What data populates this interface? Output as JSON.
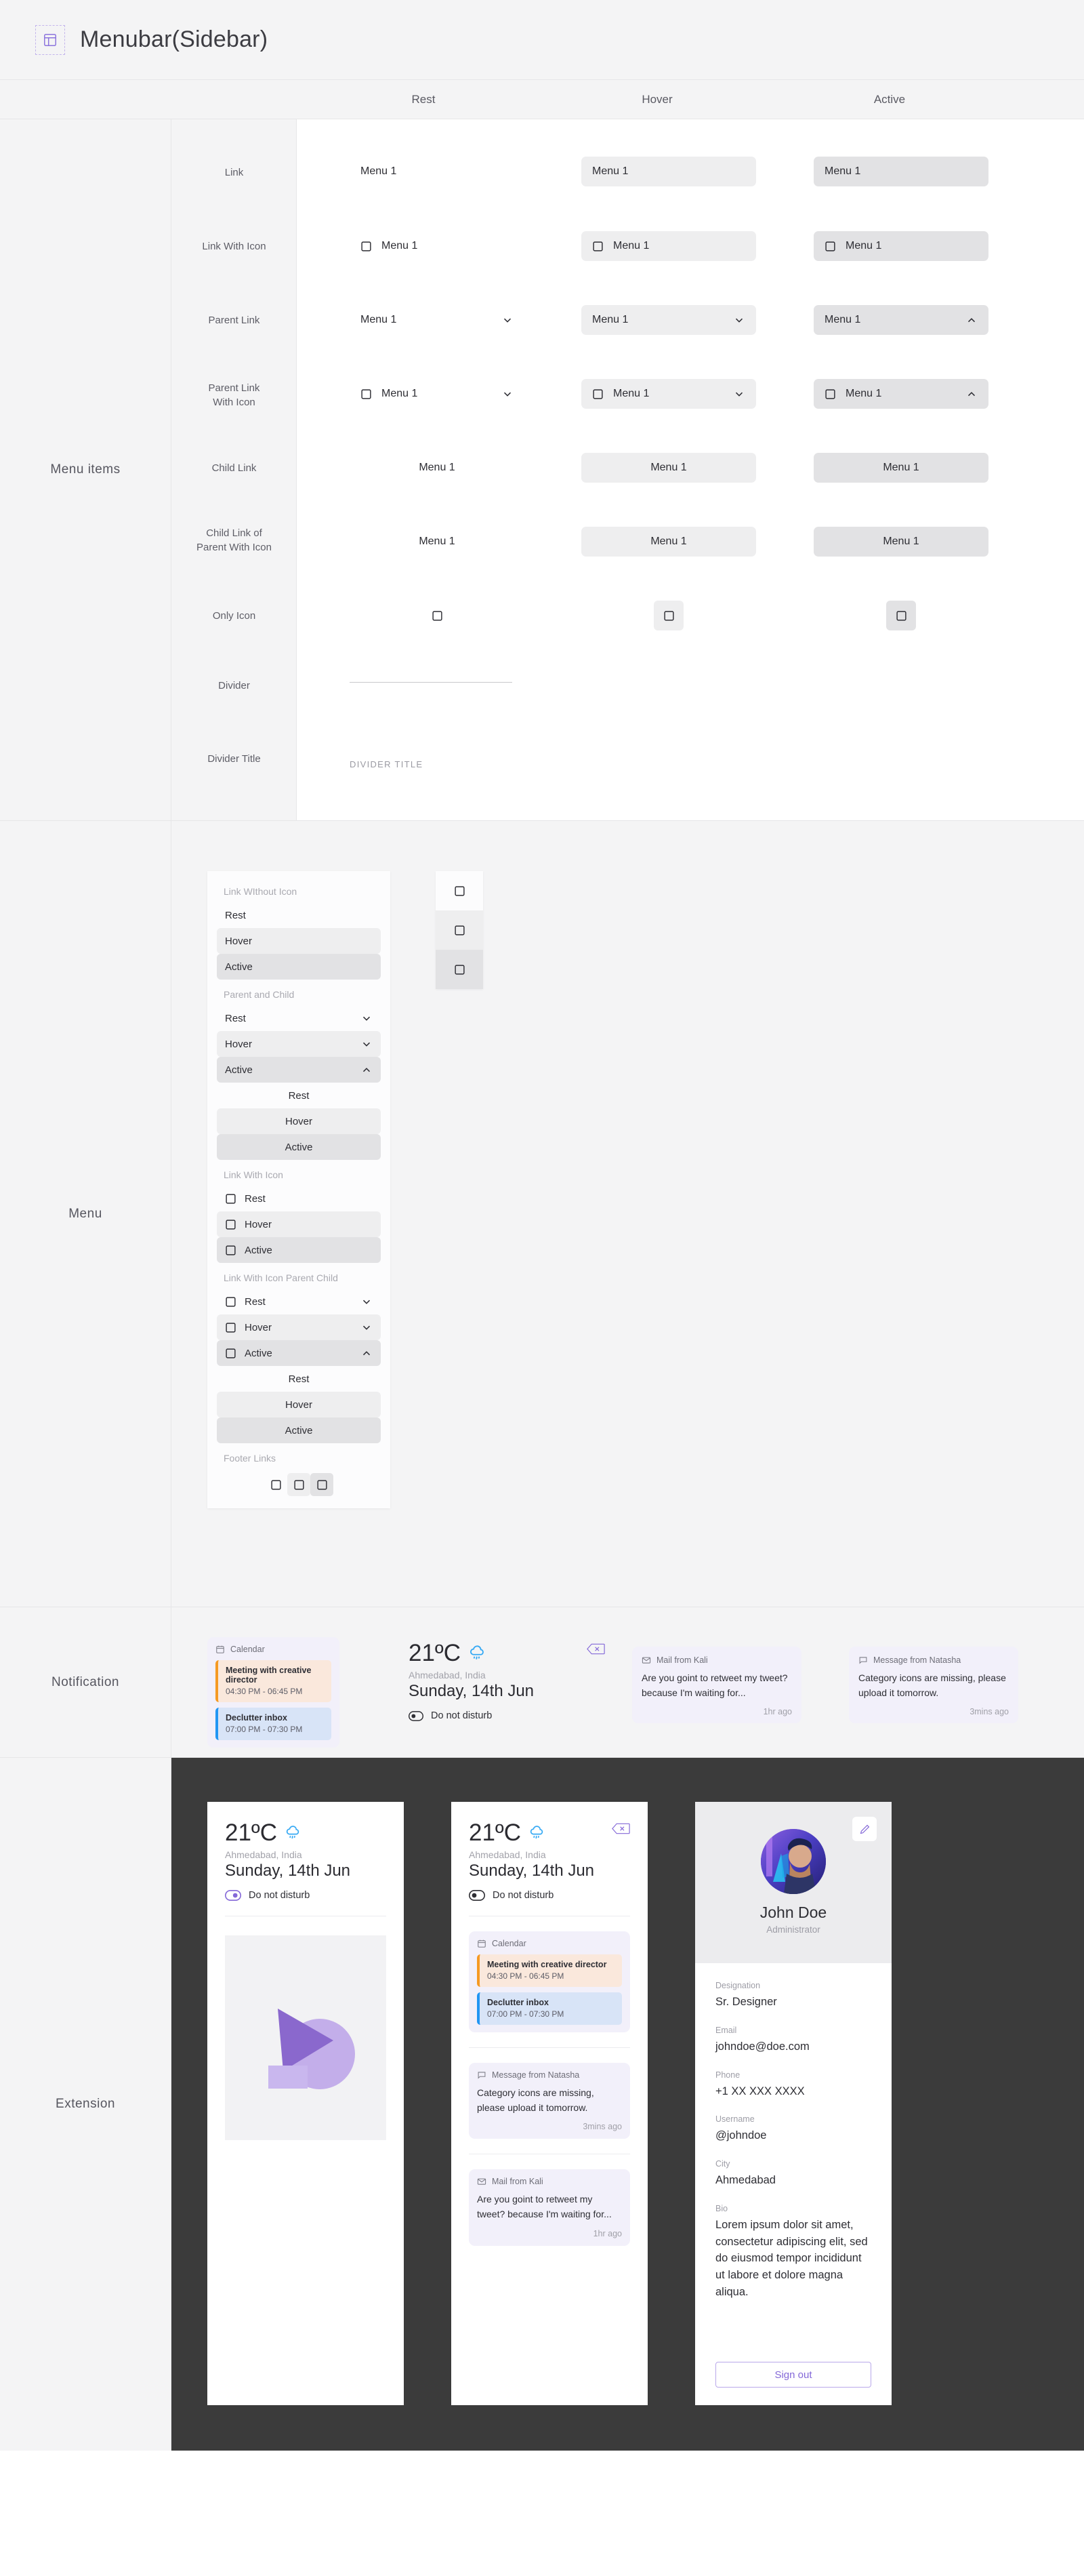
{
  "topbar": {
    "icon": "layout-sidebar-icon",
    "title": "Menubar(Sidebar)"
  },
  "state_columns": {
    "rest": "Rest",
    "hover": "Hover",
    "active": "Active"
  },
  "menu_items_section": {
    "label": "Menu items",
    "rows": [
      {
        "label": "Link",
        "sample": "Menu 1"
      },
      {
        "label": "Link With Icon",
        "sample": "Menu 1"
      },
      {
        "label": "Parent Link",
        "sample": "Menu 1"
      },
      {
        "label": "Parent Link\nWith Icon",
        "line1": "Parent Link",
        "line2": "With Icon",
        "sample": "Menu 1"
      },
      {
        "label": "Child Link",
        "sample": "Menu 1"
      },
      {
        "label": "Child Link of\nParent With Icon",
        "line1": "Child Link of",
        "line2": "Parent With Icon",
        "sample": "Menu 1"
      },
      {
        "label": "Only Icon",
        "sample": ""
      },
      {
        "label": "Divider",
        "sample": ""
      },
      {
        "label": "Divider Title",
        "sample": "DIVIDER TITLE"
      }
    ]
  },
  "menu_section": {
    "label": "Menu",
    "groups": [
      {
        "title": "Link WIthout Icon",
        "items": [
          {
            "label": "Rest",
            "state": "rest",
            "icon": false,
            "chevron": ""
          },
          {
            "label": "Hover",
            "state": "hover",
            "icon": false,
            "chevron": ""
          },
          {
            "label": "Active",
            "state": "active",
            "icon": false,
            "chevron": ""
          }
        ],
        "children": []
      },
      {
        "title": "Parent and Child",
        "items": [
          {
            "label": "Rest",
            "state": "rest",
            "icon": false,
            "chevron": "down"
          },
          {
            "label": "Hover",
            "state": "hover",
            "icon": false,
            "chevron": "down"
          },
          {
            "label": "Active",
            "state": "active",
            "icon": false,
            "chevron": "up"
          }
        ],
        "children": [
          {
            "label": "Rest",
            "state": "rest"
          },
          {
            "label": "Hover",
            "state": "hover"
          },
          {
            "label": "Active",
            "state": "active"
          }
        ]
      },
      {
        "title": "Link With Icon",
        "items": [
          {
            "label": "Rest",
            "state": "rest",
            "icon": true,
            "chevron": ""
          },
          {
            "label": "Hover",
            "state": "hover",
            "icon": true,
            "chevron": ""
          },
          {
            "label": "Active",
            "state": "active",
            "icon": true,
            "chevron": ""
          }
        ],
        "children": []
      },
      {
        "title": "Link With Icon Parent Child",
        "items": [
          {
            "label": "Rest",
            "state": "rest",
            "icon": true,
            "chevron": "down"
          },
          {
            "label": "Hover",
            "state": "hover",
            "icon": true,
            "chevron": "down"
          },
          {
            "label": "Active",
            "state": "active",
            "icon": true,
            "chevron": "up"
          }
        ],
        "children": [
          {
            "label": "Rest",
            "state": "rest"
          },
          {
            "label": "Hover",
            "state": "hover"
          },
          {
            "label": "Active",
            "state": "active"
          }
        ]
      },
      {
        "title": "Footer Links",
        "items": [],
        "children": []
      }
    ],
    "footer_links": [
      {
        "state": "rest",
        "icon": "square-icon"
      },
      {
        "state": "hover",
        "icon": "square-icon"
      },
      {
        "state": "active",
        "icon": "square-icon"
      }
    ],
    "rail": [
      {
        "state": "rest",
        "icon": "square-icon"
      },
      {
        "state": "hover",
        "icon": "square-icon"
      },
      {
        "state": "active",
        "icon": "square-icon"
      }
    ]
  },
  "notification_section": {
    "label": "Notification",
    "calendar_card": {
      "head_icon": "calendar-icon",
      "head_label": "Calendar",
      "events": [
        {
          "title": "Meeting with creative director",
          "time": "04:30 PM - 06:45 PM",
          "bg": "#fae8dc",
          "bar": "#f59a23"
        },
        {
          "title": "Declutter inbox",
          "time": "07:00 PM - 07:30 PM",
          "bg": "#d8e4f7",
          "bar": "#2196f3"
        }
      ]
    },
    "weather": {
      "temperature": "21ºC",
      "weather_icon": "rain-cloud-icon",
      "collapse_icon": "collapse-left-icon",
      "location": "Ahmedabad, India",
      "date": "Sunday, 14th Jun",
      "dnd_label": "Do not disturb",
      "dnd_on": false
    },
    "messages": [
      {
        "head_icon": "mail-icon",
        "head_label": "Mail from Kali",
        "body": "Are you goint to retweet my tweet? because I'm waiting for...",
        "time": "1hr ago"
      },
      {
        "head_icon": "chat-icon",
        "head_label": "Message from Natasha",
        "body": "Category icons are missing, please upload it tomorrow.",
        "time": "3mins ago"
      }
    ]
  },
  "extension_section": {
    "label": "Extension",
    "card1": {
      "temperature": "21ºC",
      "weather_icon": "rain-cloud-icon",
      "location": "Ahmedabad, India",
      "date": "Sunday, 14th Jun",
      "dnd_label": "Do not disturb",
      "dnd_on": true,
      "image_placeholder": "abstract-shapes-image"
    },
    "card2": {
      "temperature": "21ºC",
      "weather_icon": "rain-cloud-icon",
      "collapse_icon": "collapse-left-icon",
      "location": "Ahmedabad, India",
      "date": "Sunday, 14th Jun",
      "dnd_label": "Do not disturb",
      "dnd_on": false,
      "calendar_card": {
        "head_label": "Calendar",
        "events": [
          {
            "title": "Meeting with creative director",
            "time": "04:30 PM - 06:45 PM",
            "bg": "#fae8dc",
            "bar": "#f59a23"
          },
          {
            "title": "Declutter inbox",
            "time": "07:00 PM - 07:30 PM",
            "bg": "#d8e4f7",
            "bar": "#2196f3"
          }
        ]
      },
      "messages": [
        {
          "head_icon": "chat-icon",
          "head_label": "Message from Natasha",
          "body": "Category icons are missing, please upload it tomorrow.",
          "time": "3mins ago"
        },
        {
          "head_icon": "mail-icon",
          "head_label": "Mail from Kali",
          "body": "Are you goint to retweet my tweet? because I'm waiting for...",
          "time": "1hr ago"
        }
      ]
    },
    "profile": {
      "edit_icon": "pencil-icon",
      "avatar": "user-avatar-photo",
      "name": "John Doe",
      "role": "Administrator",
      "fields": [
        {
          "label": "Designation",
          "value": "Sr. Designer"
        },
        {
          "label": "Email",
          "value": "johndoe@doe.com"
        },
        {
          "label": "Phone",
          "value": "+1 XX XXX XXXX"
        },
        {
          "label": "Username",
          "value": "@johndoe"
        },
        {
          "label": "City",
          "value": "Ahmedabad"
        },
        {
          "label": "Bio",
          "value": "Lorem ipsum dolor sit amet, consectetur adipiscing elit, sed do eiusmod tempor incididunt ut labore et dolore magna aliqua."
        }
      ],
      "signout_label": "Sign out"
    }
  },
  "colors": {
    "accent": "#8468d8",
    "hover_bg": "#eeeeef",
    "active_bg": "#e2e2e4",
    "notif_bg": "#f2f0fa",
    "page_bg": "#f4f4f5",
    "dark_bg": "#3b3b3b"
  }
}
